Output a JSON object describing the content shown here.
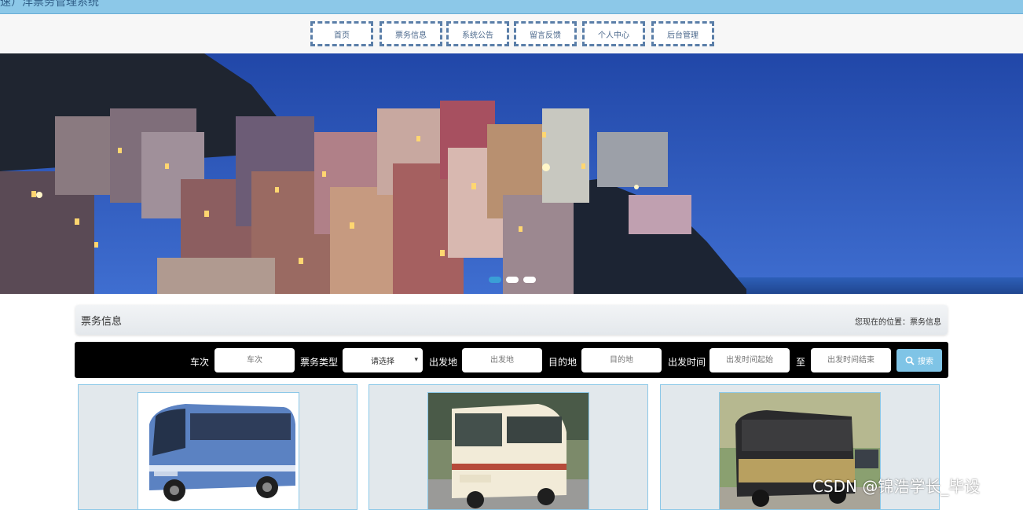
{
  "app": {
    "title": "速）洋票务管理系统"
  },
  "nav": {
    "items": [
      {
        "label": "首页"
      },
      {
        "label": "票务信息"
      },
      {
        "label": "系统公告"
      },
      {
        "label": "留言反馈"
      },
      {
        "label": "个人中心"
      },
      {
        "label": "后台管理"
      }
    ]
  },
  "banner": {
    "slide_count": 3,
    "active_slide": 1
  },
  "section": {
    "title": "票务信息",
    "location": "您现在的位置：票务信息"
  },
  "search": {
    "train_label": "车次",
    "train_placeholder": "车次",
    "type_label": "票务类型",
    "type_value": "请选择",
    "from_label": "出发地",
    "from_placeholder": "出发地",
    "to_label": "目的地",
    "to_placeholder": "目的地",
    "time_label": "出发时间",
    "time_start_placeholder": "出发时间起始",
    "time_sep": "至",
    "time_end_placeholder": "出发时间结束",
    "button_label": "搜索",
    "button_icon": "search-icon"
  },
  "cards": [
    {
      "image": "blue-coach-bus"
    },
    {
      "image": "cream-minibus"
    },
    {
      "image": "gold-double-decker-bus"
    }
  ],
  "watermark": "CSDN @锦浩学长_毕设",
  "colors": {
    "topbar": "#8cc8e8",
    "nav_border": "#5a7ea8",
    "search_bg": "#000000",
    "search_button": "#7fc4e6",
    "card_bg": "#e2e8ec"
  }
}
